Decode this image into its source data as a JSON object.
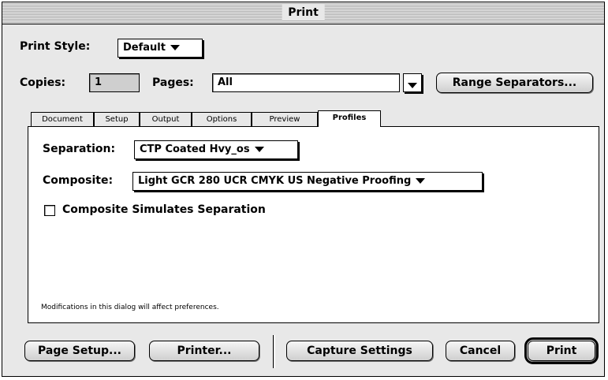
{
  "window": {
    "title": "Print"
  },
  "print_style": {
    "label": "Print Style:",
    "value": "Default"
  },
  "copies": {
    "label": "Copies:",
    "value": "1"
  },
  "pages": {
    "label": "Pages:",
    "value": "All"
  },
  "buttons": {
    "range_separators": "Range Separators...",
    "page_setup": "Page Setup...",
    "printer": "Printer...",
    "capture_settings": "Capture Settings",
    "cancel": "Cancel",
    "print": "Print"
  },
  "tabs": [
    {
      "label": "Document",
      "active": false
    },
    {
      "label": "Setup",
      "active": false
    },
    {
      "label": "Output",
      "active": false
    },
    {
      "label": "Options",
      "active": false
    },
    {
      "label": "Preview",
      "active": false
    },
    {
      "label": "Profiles",
      "active": true
    }
  ],
  "profiles": {
    "separation_label": "Separation:",
    "separation_value": "CTP Coated Hvy_os",
    "composite_label": "Composite:",
    "composite_value": "Light GCR 280 UCR CMYK US Negative Proofing",
    "simulate_label": "Composite Simulates Separation",
    "simulate_checked": false,
    "note": "Modifications in this dialog will affect preferences."
  }
}
